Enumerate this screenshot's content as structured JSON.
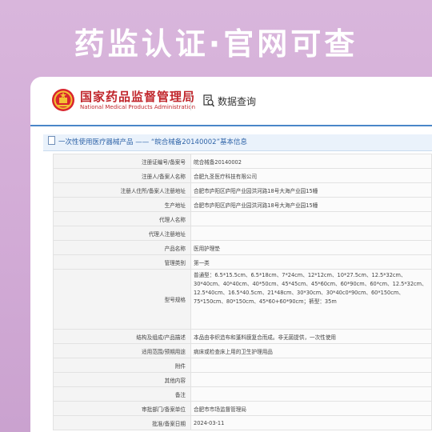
{
  "headline": "药监认证·官网可查",
  "header": {
    "org_cn": "国家药品监督管理局",
    "org_en": "National Medical Products Administration",
    "query_label": "数据查询"
  },
  "section_title": "一次性使用医疗器械产品 —— “皖合械备20140002”基本信息",
  "rows": [
    {
      "label": "注册证编号/备案号",
      "value": "皖合械备20140002"
    },
    {
      "label": "注册人/备案人名称",
      "value": "合肥九圣医疗科技有限公司"
    },
    {
      "label": "注册人住所/备案人注册地址",
      "value": "合肥市庐阳区庐阳产业园洪河路18号大海产业园15幢"
    },
    {
      "label": "生产地址",
      "value": "合肥市庐阳区庐阳产业园洪河路18号大海产业园15幢"
    },
    {
      "label": "代理人名称",
      "value": ""
    },
    {
      "label": "代理人注册地址",
      "value": ""
    },
    {
      "label": "产品名称",
      "value": "医用护理垫"
    },
    {
      "label": "管理类别",
      "value": "第一类"
    },
    {
      "label": "型号规格",
      "value": "普通型：6.5*15.5cm、6.5*18cm、7*24cm、12*12cm、10*27.5cm、12.5*32cm、30*40cm、40*40cm、40*50cm、45*45cm、45*60cm、60*90cm、60*cm、12.5*32cm、12.5*40cm、16.5*40.5cm、21*48cm、30*30cm、30*40c0*90cm、60*150cm、75*150cm、80*150cm、45*60+60*90cm；裤型：35m"
    },
    {
      "label": "结构及组成/产品描述",
      "value": "本品由非织造布和蓬料膜复合而成。非无菌提供，一次性使用"
    },
    {
      "label": "适用范围/预期用途",
      "value": "病床或检查床上用的卫生护理用品"
    },
    {
      "label": "附件",
      "value": ""
    },
    {
      "label": "其他内容",
      "value": ""
    },
    {
      "label": "备注",
      "value": ""
    },
    {
      "label": "审批部门/备案单位",
      "value": "合肥市市场监督管理局"
    },
    {
      "label": "批准/备案日期",
      "value": "2024-03-11"
    }
  ],
  "icons": {
    "emblem": "national-emblem-icon",
    "query": "document-search-icon",
    "section": "document-icon"
  },
  "colors": {
    "accent_red": "#c1272d",
    "accent_blue": "#4a86c8",
    "background": "#d2abd6"
  }
}
